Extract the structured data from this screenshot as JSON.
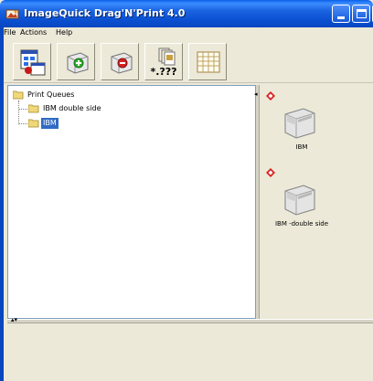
{
  "window": {
    "title": "ImageQuick Drag'N'Print 4.0"
  },
  "menu": {
    "items": [
      "File",
      "Actions",
      "Help"
    ]
  },
  "toolbar": {
    "buttons": [
      {
        "icon": "queue-properties-icon"
      },
      {
        "icon": "add-printer-icon"
      },
      {
        "icon": "remove-printer-icon"
      },
      {
        "icon": "file-types-icon",
        "label": "*.???"
      },
      {
        "icon": "grid-layout-icon"
      }
    ]
  },
  "tree": {
    "root": "Print Queues",
    "children": [
      {
        "label": "IBM double side",
        "selected": false
      },
      {
        "label": "IBM",
        "selected": true
      }
    ]
  },
  "printers": [
    {
      "label": "IBM"
    },
    {
      "label": "IBM -double side"
    }
  ],
  "colors": {
    "titlebar": "#0a4fd0",
    "selection": "#316ac5",
    "background": "#ece9d8",
    "close_button": "#d8482a"
  }
}
